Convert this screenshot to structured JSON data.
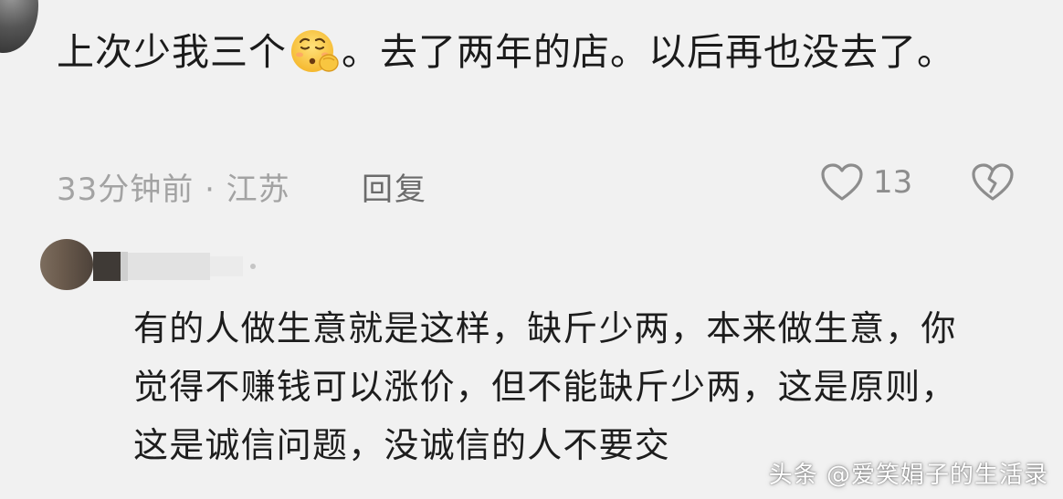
{
  "comment": {
    "text_before_emoji": "上次少我三个",
    "emoji": "hushed-sleepy-face-emoji",
    "text_after_emoji": "。去了两年的店。以后再也没去了。",
    "time_location": "33分钟前 · 江苏",
    "reply_label": "回复",
    "like_count": "13"
  },
  "reply": {
    "text": "有的人做生意就是这样，缺斤少两，本来做生意，你觉得不赚钱可以涨价，但不能缺斤少两，这是原则，这是诚信问题，没诚信的人不要交"
  },
  "watermark": "头条 @爱笑娟子的生活录",
  "colors": {
    "background": "#f1f1f1",
    "text": "#1b1b1b",
    "meta": "#a3a3a3",
    "reply_btn": "#6b6b6b",
    "icon": "#8d8d8d"
  }
}
